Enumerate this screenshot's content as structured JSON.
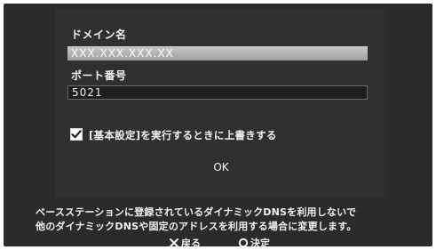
{
  "form": {
    "domain_label": "ドメイン名",
    "domain_value": "XXX.XXX.XXX.XX",
    "port_label": "ポート番号",
    "port_value": "5021",
    "checkbox_label": "[基本設定]を実行するときに上書きする",
    "checkbox_checked": true,
    "ok_label": "OK"
  },
  "notice": {
    "line1": "ベースステーションに登録されているダイナミックDNSを利用しないで",
    "line2": "他のダイナミックDNSや固定のアドレスを利用する場合に変更します。"
  },
  "footer": {
    "back_label": "戻る",
    "confirm_label": "決定"
  },
  "colors": {
    "background": "#2b2b2b",
    "selected_field": "#b4b4b4",
    "text": "#f2f2f2"
  },
  "icons": {
    "back": "cross-icon",
    "confirm": "circle-icon",
    "checkbox": "checkmark-icon"
  }
}
